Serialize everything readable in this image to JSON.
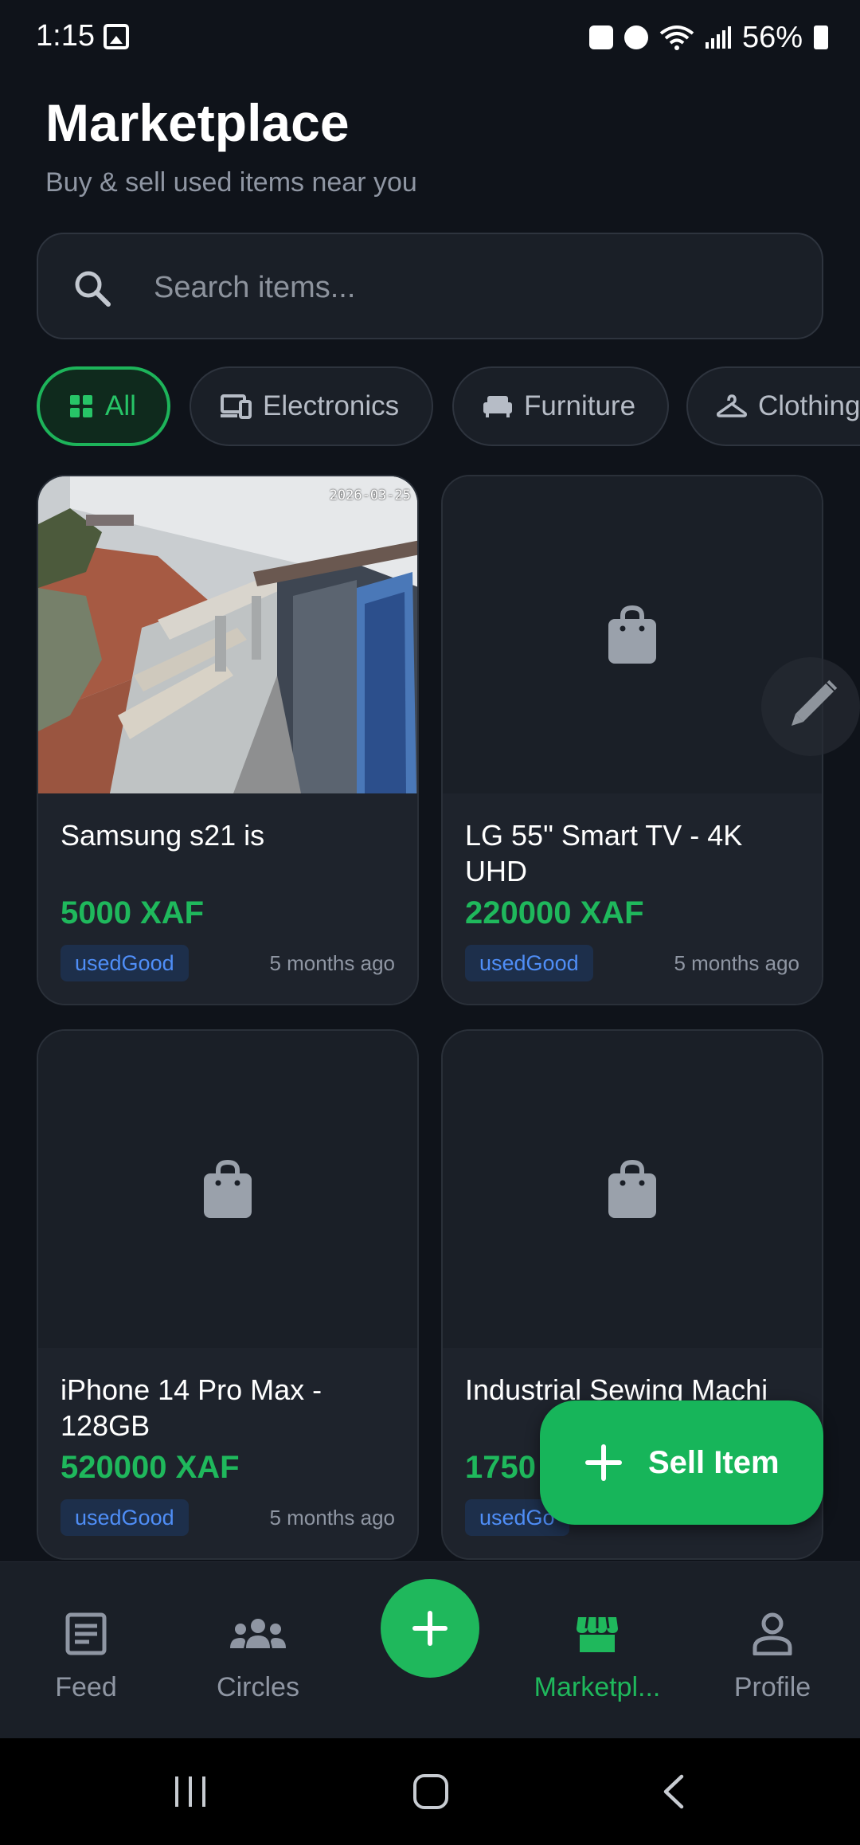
{
  "status_bar": {
    "time": "1:15",
    "battery": "56%"
  },
  "header": {
    "title": "Marketplace",
    "subtitle": "Buy & sell used items near you"
  },
  "search": {
    "placeholder": "Search items..."
  },
  "categories": [
    {
      "label": "All",
      "icon": "grid-icon",
      "active": true
    },
    {
      "label": "Electronics",
      "icon": "devices-icon",
      "active": false
    },
    {
      "label": "Furniture",
      "icon": "sofa-icon",
      "active": false
    },
    {
      "label": "Clothing",
      "icon": "hanger-icon",
      "active": false
    }
  ],
  "listings": [
    {
      "title": "Samsung s21 is",
      "price": "5000 XAF",
      "condition": "usedGood",
      "time": "5 months ago",
      "image": "photo",
      "photo_stamp": "2026-03-25"
    },
    {
      "title": "LG 55\" Smart TV - 4K UHD",
      "price": "220000 XAF",
      "condition": "usedGood",
      "time": "5 months ago",
      "image": "placeholder-bag-icon"
    },
    {
      "title": "iPhone 14 Pro Max - 128GB",
      "price": "520000 XAF",
      "condition": "usedGood",
      "time": "5 months ago",
      "image": "placeholder-bag-icon"
    },
    {
      "title": "Industrial Sewing Machi",
      "price": "1750",
      "condition": "usedGo",
      "time": "",
      "image": "placeholder-bag-icon"
    }
  ],
  "fab": {
    "label": "Sell Item"
  },
  "bottom_nav": [
    {
      "label": "Feed",
      "icon": "feed-icon",
      "active": false
    },
    {
      "label": "Circles",
      "icon": "groups-icon",
      "active": false
    },
    {
      "label": "Marketpl...",
      "icon": "store-icon",
      "active": true
    },
    {
      "label": "Profile",
      "icon": "person-icon",
      "active": false
    }
  ],
  "colors": {
    "background": "#0f131a",
    "surface": "#1a1f27",
    "accent": "#1fb85c",
    "badge_text": "#4f8ef7",
    "muted_text": "#8f96a3"
  }
}
